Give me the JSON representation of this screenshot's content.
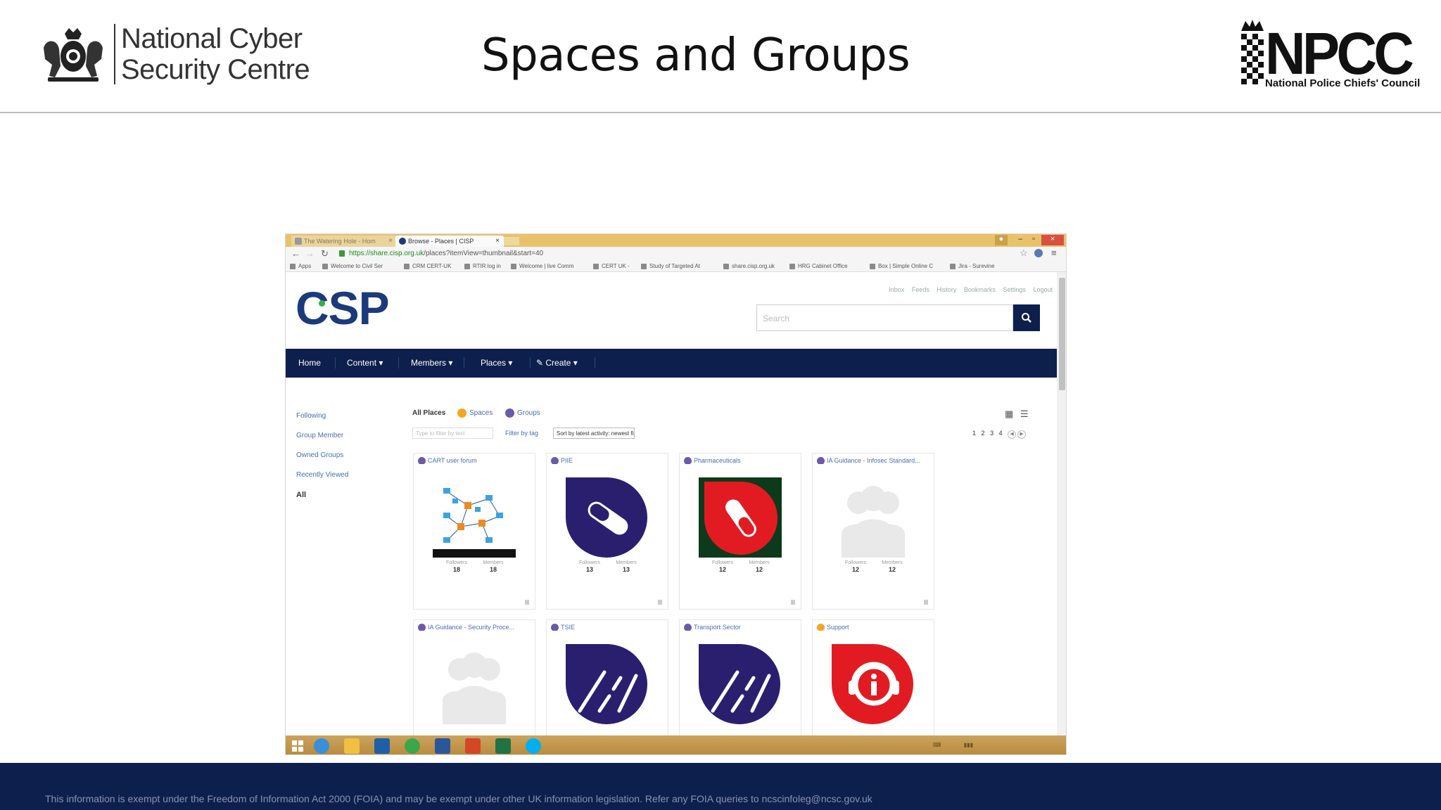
{
  "slide": {
    "title": "Spaces and Groups",
    "ncsc_line1": "National Cyber",
    "ncsc_line2": "Security Centre",
    "npcc_word": "NPCC",
    "npcc_sub": "National Police Chiefs' Council",
    "footer": "This information is exempt under the Freedom of Information Act 2000 (FOIA) and may be exempt under other UK information legislation. Refer any FOIA queries to ncscinfoleg@ncsc.gov.uk"
  },
  "browser": {
    "tabs": [
      {
        "label": "The Watering Hole - Hom"
      },
      {
        "label": "Browse - Places | CISP"
      }
    ],
    "url_host": "https://share.cisp.org.uk",
    "url_path": "/places?itemView=thumbnail&start=40",
    "bookmarks": [
      "Apps",
      "Welcome to Civil Ser",
      "CRM CERT-UK",
      "RTIR log in",
      "Welcome | live Comm",
      "CERT UK -",
      "Study of Targeted At",
      "share.cisp.org.uk",
      "HRG Cabinet Office",
      "Box | Simple Online C",
      "Jira - Surevine"
    ]
  },
  "site": {
    "logo": "CSP",
    "toplinks": [
      "Inbox",
      "Feeds",
      "History",
      "Bookmarks",
      "Settings",
      "Logout"
    ],
    "search_placeholder": "Search",
    "nav": [
      "Home",
      "Content ▾",
      "Members ▾",
      "Places ▾",
      "Create ▾"
    ],
    "sidebar": [
      "Following",
      "Group Member",
      "Owned Groups",
      "Recently Viewed",
      "All"
    ],
    "filters": {
      "all": "All Places",
      "spaces": "Spaces",
      "groups": "Groups",
      "filter_placeholder": "Type to filter by text",
      "tag_label": "Filter by tag",
      "sort": "Sort by latest activity: newest first"
    },
    "pager": [
      "1",
      "2",
      "3",
      "4"
    ],
    "stat_labels": {
      "followers": "Followers",
      "members": "Members"
    },
    "cards": [
      {
        "title": "CART user forum",
        "kind": "group",
        "followers": "18",
        "members": "18"
      },
      {
        "title": "PIIE",
        "kind": "group",
        "followers": "13",
        "members": "13"
      },
      {
        "title": "Pharmaceuticals",
        "kind": "group",
        "followers": "12",
        "members": "12"
      },
      {
        "title": "IA Guidance - Infosec Standard...",
        "kind": "group",
        "followers": "12",
        "members": "12"
      },
      {
        "title": "IA Guidance - Security Proce...",
        "kind": "group",
        "followers": "",
        "members": ""
      },
      {
        "title": "TSIE",
        "kind": "group",
        "followers": "",
        "members": ""
      },
      {
        "title": "Transport Sector",
        "kind": "group",
        "followers": "",
        "members": ""
      },
      {
        "title": "Support",
        "kind": "space",
        "followers": "",
        "members": ""
      }
    ]
  },
  "colors": {
    "navy": "#0d1f4d",
    "link_blue": "#4a6db0",
    "csp_blue": "#1b3a7a",
    "pill_purple": "#2a1f6e",
    "alert_red": "#e21b23"
  }
}
